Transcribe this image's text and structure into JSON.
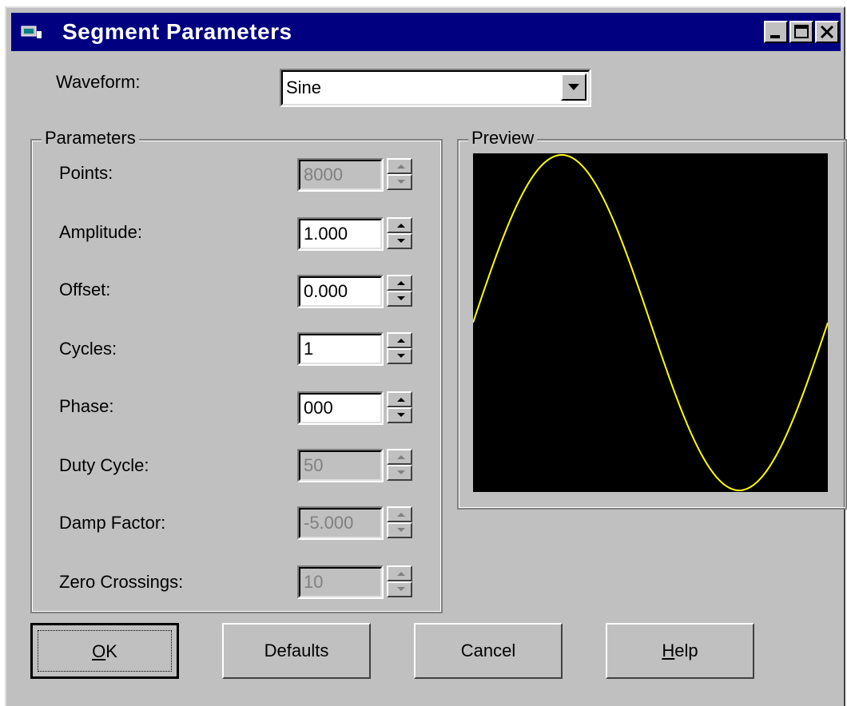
{
  "window": {
    "title": "Segment Parameters",
    "title_bar_color": "#000080",
    "controls": {
      "minimize": "minimize-icon",
      "maximize": "maximize-icon",
      "close": "close-icon"
    }
  },
  "waveform": {
    "label": "Waveform:",
    "value": "Sine"
  },
  "parameters": {
    "group_title": "Parameters",
    "fields": [
      {
        "label": "Points:",
        "value": "8000",
        "enabled": false
      },
      {
        "label": "Amplitude:",
        "value": "1.000",
        "enabled": true
      },
      {
        "label": "Offset:",
        "value": "0.000",
        "enabled": true
      },
      {
        "label": "Cycles:",
        "value": "1",
        "enabled": true
      },
      {
        "label": "Phase:",
        "value": "000",
        "enabled": true
      },
      {
        "label": "Duty Cycle:",
        "value": "50",
        "enabled": false
      },
      {
        "label": "Damp Factor:",
        "value": "-5.000",
        "enabled": false
      },
      {
        "label": "Zero Crossings:",
        "value": "10",
        "enabled": false
      }
    ]
  },
  "preview": {
    "group_title": "Preview",
    "background": "#000000",
    "trace_color": "#ffff00"
  },
  "chart_data": {
    "type": "line",
    "series": [
      {
        "function": "sine",
        "amplitude": 1.0,
        "offset": 0.0,
        "cycles": 1,
        "phase": 0
      }
    ],
    "ylim": [
      -1,
      1
    ]
  },
  "buttons": {
    "ok": {
      "prefix": "",
      "mnemonic": "O",
      "suffix": "K"
    },
    "defaults": "Defaults",
    "cancel": "Cancel",
    "help": {
      "prefix": "",
      "mnemonic": "H",
      "suffix": "elp"
    }
  }
}
